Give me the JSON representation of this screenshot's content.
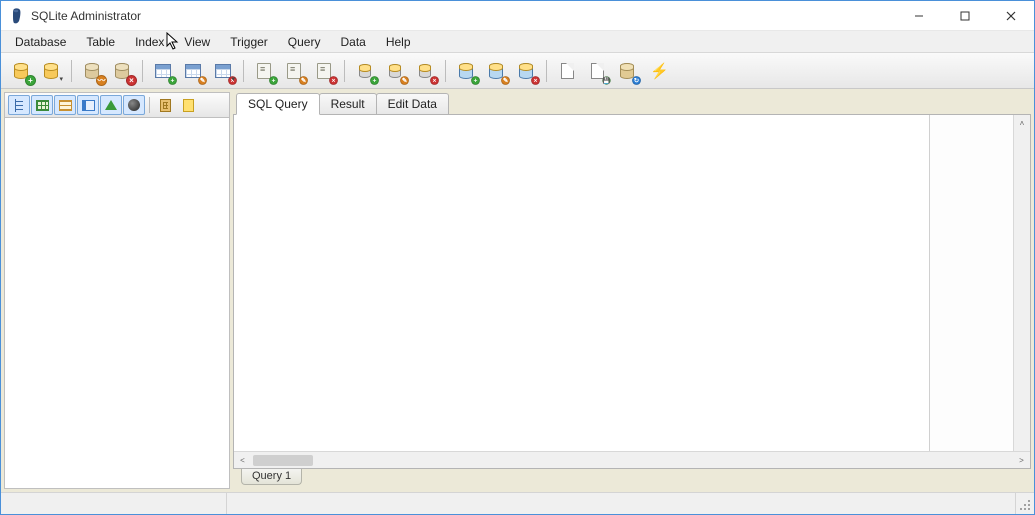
{
  "title": "SQLite Administrator",
  "menu": {
    "database": "Database",
    "table": "Table",
    "index": "Index",
    "view": "View",
    "trigger": "Trigger",
    "query": "Query",
    "data": "Data",
    "help": "Help"
  },
  "tabs": {
    "sql_query": "SQL Query",
    "result": "Result",
    "edit_data": "Edit Data"
  },
  "bottom_tabs": {
    "query1": "Query 1"
  },
  "toolbar": {
    "new_db": "new-database",
    "open_db": "open-database",
    "attach_db": "attach-database",
    "close_db": "close-database",
    "new_table": "new-table",
    "edit_table": "edit-table",
    "drop_table": "drop-table",
    "new_query": "new-query",
    "edit_query": "edit-query",
    "drop_query": "drop-query",
    "new_index": "new-index",
    "edit_index": "edit-index",
    "drop_index": "drop-index",
    "new_view": "new-view",
    "edit_view": "edit-view",
    "drop_view": "drop-view",
    "export": "export",
    "save_sql": "save-sql",
    "refresh": "refresh",
    "execute": "execute"
  },
  "side_toolbar": {
    "tree": "tree-view",
    "grid": "grid-view",
    "rows": "rows-view",
    "form": "form-view",
    "tri": "triggers-view",
    "sys": "system-view",
    "bld": "objects-view",
    "note": "notes-view"
  }
}
